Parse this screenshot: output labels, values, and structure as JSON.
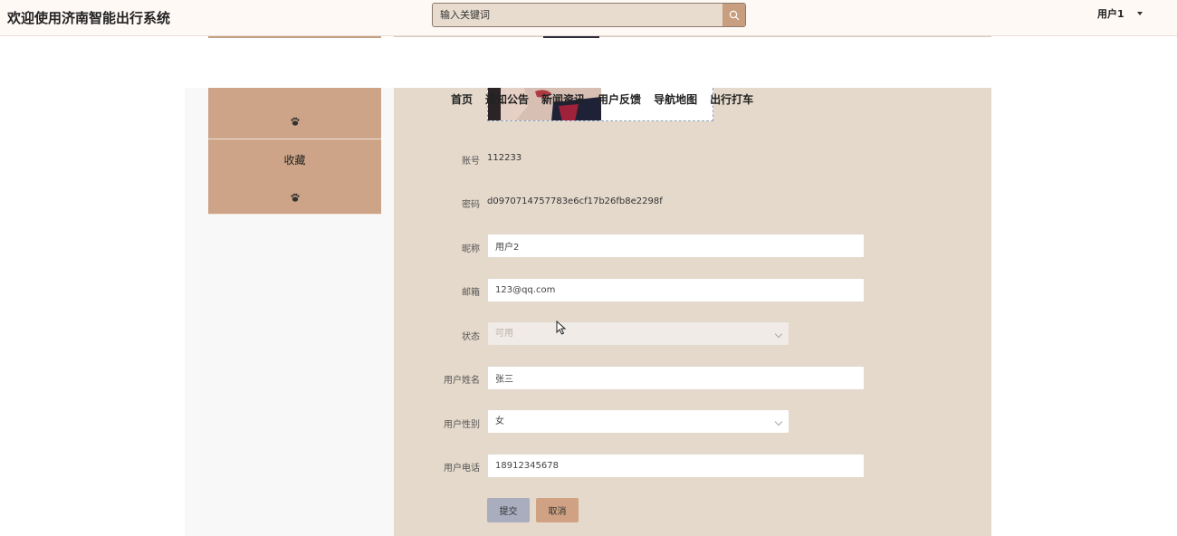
{
  "header": {
    "site_title": "欢迎使用济南智能出行系统",
    "search_placeholder": "输入关键词",
    "search_icon": "search-icon",
    "user_label": "用户1"
  },
  "nav": {
    "items": [
      "首页",
      "通知公告",
      "新闻资讯",
      "用户反馈",
      "导航地图",
      "出行打车"
    ]
  },
  "sidebar": {
    "items": [
      {
        "label": "",
        "icon": "paw-icon"
      },
      {
        "label": "收藏",
        "icon": "paw-icon"
      }
    ]
  },
  "form": {
    "account_label": "账号",
    "account_value": "112233",
    "password_label": "密码",
    "password_value": "d0970714757783e6cf17b26fb8e2298f",
    "nickname_label": "昵称",
    "nickname_value": "用户2",
    "email_label": "邮箱",
    "email_value": "123@qq.com",
    "status_label": "状态",
    "status_value": "可用",
    "name_label": "用户姓名",
    "name_value": "张三",
    "gender_label": "用户性别",
    "gender_value": "女",
    "phone_label": "用户电话",
    "phone_value": "18912345678"
  },
  "buttons": {
    "submit": "提交",
    "cancel": "取消"
  },
  "colors": {
    "accent": "#cda487",
    "main_bg": "#e5d9cb",
    "submit_bg": "#a9adbe",
    "cancel_bg": "#d0a283"
  }
}
